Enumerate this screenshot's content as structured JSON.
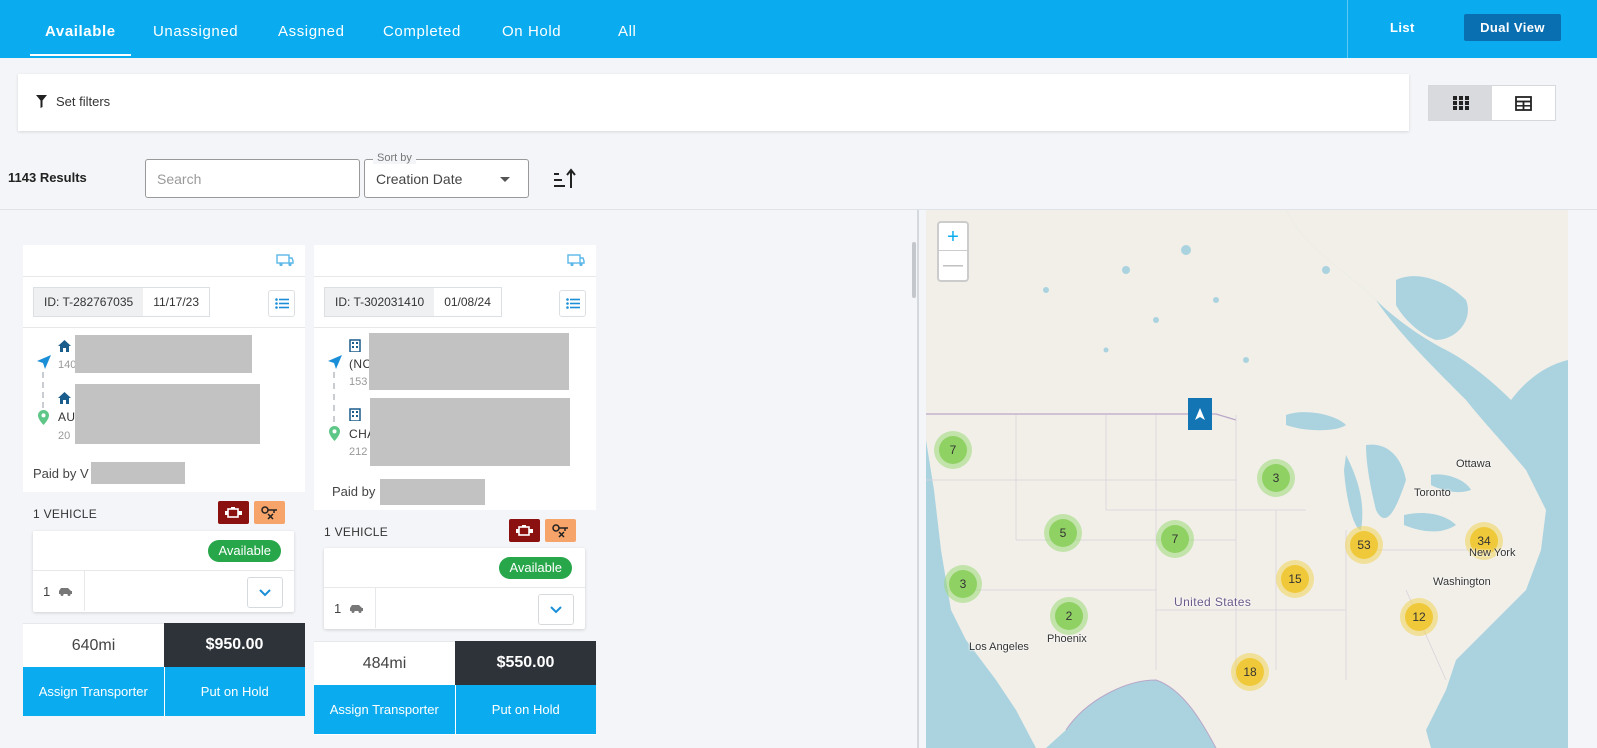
{
  "nav": {
    "tabs": [
      "Available",
      "Unassigned",
      "Assigned",
      "Completed",
      "On Hold",
      "All"
    ],
    "active_tab": "Available",
    "view_list": "List",
    "view_dual": "Dual View"
  },
  "filters": {
    "label": "Set filters",
    "layout_options": [
      "grid-view-icon",
      "table-view-icon"
    ],
    "active_layout": "grid-view-icon"
  },
  "results": {
    "count_label": "1143 Results",
    "search_placeholder": "Search",
    "sort_label": "Sort by",
    "sort_value": "Creation Date"
  },
  "cards": [
    {
      "id": "ID: T-282767035",
      "date": "11/17/23",
      "origin_icon": "home-icon",
      "origin_line1": "",
      "origin_line2": "140",
      "dest_icon": "home-icon",
      "dest_line1": "AU",
      "dest_line2": "20",
      "paid_by": "Paid by V",
      "vehicle_count_label": "1 VEHICLE",
      "status": "Available",
      "vehicle_qty": "1",
      "miles": "640mi",
      "price": "$950.00",
      "assign_label": "Assign Transporter",
      "hold_label": "Put on Hold"
    },
    {
      "id": "ID: T-302031410",
      "date": "01/08/24",
      "origin_icon": "building-icon",
      "origin_line1": "(NC",
      "origin_line2": "153",
      "dest_icon": "building-icon",
      "dest_line1": "CHA",
      "dest_line2": "212",
      "paid_by": "Paid by",
      "vehicle_count_label": "1 VEHICLE",
      "status": "Available",
      "vehicle_qty": "1",
      "miles": "484mi",
      "price": "$550.00",
      "assign_label": "Assign Transporter",
      "hold_label": "Put on Hold"
    }
  ],
  "map": {
    "zoom_in": "+",
    "zoom_out": "—",
    "clusters": [
      {
        "count": "7",
        "color": "green"
      },
      {
        "count": "3",
        "color": "green"
      },
      {
        "count": "5",
        "color": "green"
      },
      {
        "count": "7",
        "color": "green"
      },
      {
        "count": "3",
        "color": "green"
      },
      {
        "count": "2",
        "color": "green"
      },
      {
        "count": "53",
        "color": "yellow"
      },
      {
        "count": "34",
        "color": "yellow"
      },
      {
        "count": "15",
        "color": "yellow"
      },
      {
        "count": "12",
        "color": "yellow"
      },
      {
        "count": "18",
        "color": "yellow"
      }
    ],
    "labels": {
      "ottawa": "Ottawa",
      "toronto": "Toronto",
      "new_york": "New York",
      "washington": "Washington",
      "united_states": "United States",
      "phoenix": "Phoenix",
      "los_angeles": "Los Angeles"
    }
  },
  "colors": {
    "primary": "#0aacef",
    "dark_button": "#0a6fb0",
    "price_bg": "#2d3338",
    "status_green": "#28a64a",
    "engine_badge": "#8b1010",
    "key_badge": "#f7a46a"
  }
}
